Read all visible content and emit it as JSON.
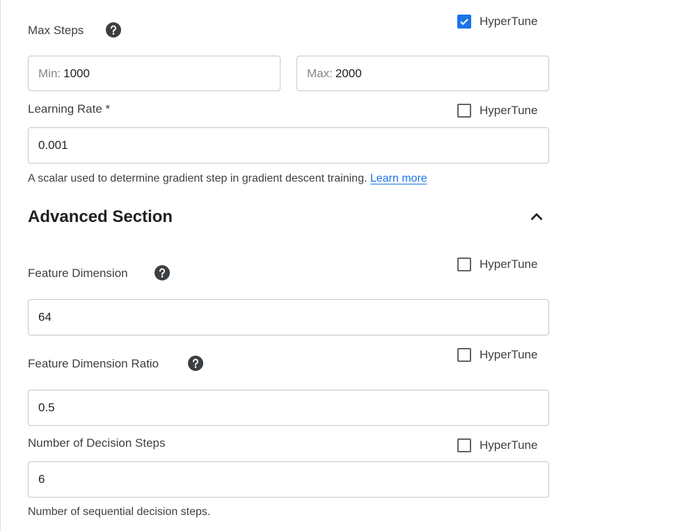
{
  "max_steps": {
    "label": "Max Steps",
    "help_icon": "help-circle-icon",
    "hypertune_label": "HyperTune",
    "hypertune_checked": true,
    "min_prefix": "Min:",
    "min_value": "1000",
    "max_prefix": "Max:",
    "max_value": "2000"
  },
  "learning_rate": {
    "label": "Learning Rate *",
    "hypertune_label": "HyperTune",
    "hypertune_checked": false,
    "value": "0.001",
    "hint": "A scalar used to determine gradient step in gradient descent training.",
    "learn_more": "Learn more"
  },
  "advanced": {
    "title": "Advanced Section",
    "toggle_icon": "chevron-up-icon"
  },
  "feature_dimension": {
    "label": "Feature Dimension",
    "help_icon": "help-circle-icon",
    "hypertune_label": "HyperTune",
    "hypertune_checked": false,
    "value": "64"
  },
  "feature_dimension_ratio": {
    "label": "Feature Dimension Ratio",
    "help_icon": "help-circle-icon",
    "hypertune_label": "HyperTune",
    "hypertune_checked": false,
    "value": "0.5"
  },
  "decision_steps": {
    "label": "Number of Decision Steps",
    "hypertune_label": "HyperTune",
    "hypertune_checked": false,
    "value": "6",
    "hint": "Number of sequential decision steps."
  },
  "colors": {
    "accent": "#1a73e8",
    "border": "#c4c7c5",
    "text": "#3c4043"
  }
}
